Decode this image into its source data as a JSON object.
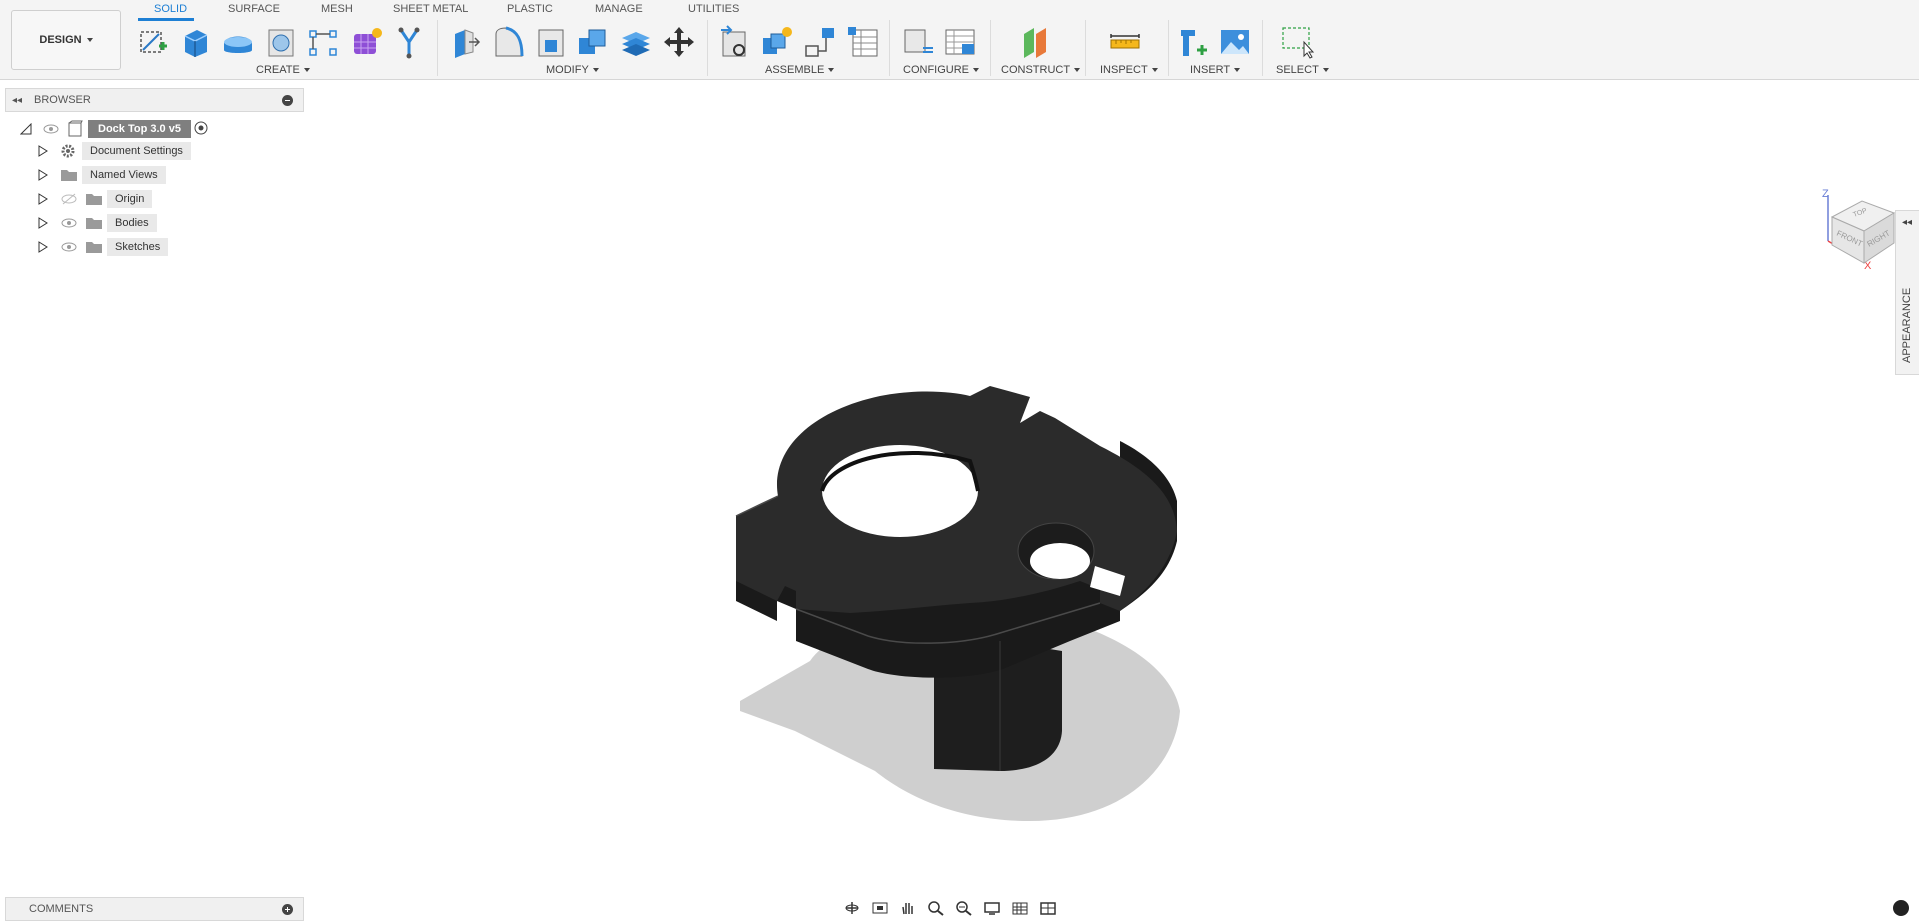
{
  "workspace": {
    "label": "DESIGN"
  },
  "tabs": [
    "SOLID",
    "SURFACE",
    "MESH",
    "SHEET METAL",
    "PLASTIC",
    "MANAGE",
    "UTILITIES"
  ],
  "groups": {
    "create": "CREATE",
    "modify": "MODIFY",
    "assemble": "ASSEMBLE",
    "configure": "CONFIGURE",
    "construct": "CONSTRUCT",
    "inspect": "INSPECT",
    "insert": "INSERT",
    "select": "SELECT"
  },
  "browser": {
    "title": "BROWSER",
    "root": "Dock Top 3.0 v5",
    "items": [
      "Document Settings",
      "Named Views",
      "Origin",
      "Bodies",
      "Sketches"
    ]
  },
  "viewcube": {
    "top": "TOP",
    "front": "FRONT",
    "right": "RIGHT",
    "axis_z": "Z",
    "axis_x": "X"
  },
  "appearance": "APPEARANCE",
  "comments": "COMMENTS",
  "colors": {
    "accent": "#1d7fd4",
    "model": "#262626",
    "shadow": "#cfcfcf"
  },
  "icons": [
    "create-sketch-icon",
    "extrude-icon",
    "revolve-icon",
    "hole-icon",
    "pattern-icon",
    "form-icon",
    "sweep-icon",
    "press-pull-icon",
    "fillet-icon",
    "shell-icon",
    "combine-icon",
    "offset-face-icon",
    "move-icon",
    "new-component-icon",
    "joint-icon",
    "as-built-joint-icon",
    "joint-table-icon",
    "configure-icon",
    "parameters-icon",
    "construct-plane-icon",
    "measure-icon",
    "insert-derive-icon",
    "insert-image-icon",
    "select-window-icon"
  ]
}
